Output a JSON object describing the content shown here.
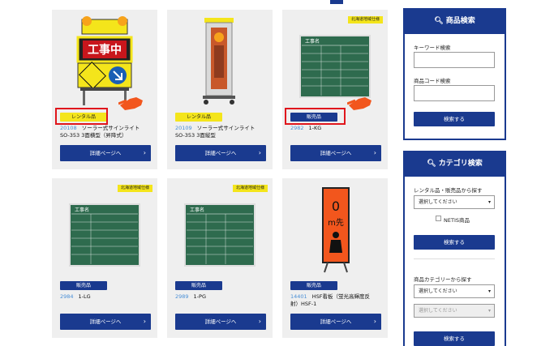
{
  "products": [
    {
      "badge": "レンタル品",
      "code": "20108",
      "name1": "ソーラー式サインライト",
      "name2": "SO-353 3面横型（昇降式）",
      "button": "詳細ページへ"
    },
    {
      "badge": "レンタル品",
      "code": "20109",
      "name1": "ソーラー式サインライト",
      "name2": "SO-353 3面縦型",
      "button": "詳細ページへ"
    },
    {
      "badge": "販売品",
      "code": "2982",
      "name1": "1-KG",
      "tag": "北海道地域仕様",
      "button": "詳細ページへ"
    },
    {
      "badge": "販売品",
      "code": "2984",
      "name1": "1-LG",
      "tag": "北海道地域仕様",
      "button": "詳細ページへ"
    },
    {
      "badge": "販売品",
      "code": "2989",
      "name1": "1-PG",
      "tag": "北海道地域仕様",
      "button": "詳細ページへ"
    },
    {
      "badge": "販売品",
      "code": "14401",
      "name1": "HSF看板（蛍光高輝度反",
      "name2": "射）HSF-1",
      "button": "詳細ページへ"
    }
  ],
  "sign_text": "工事中",
  "board": {
    "title": "工事名",
    "rows": [
      "工　　種",
      "施工場所",
      "位　　置",
      "設計寸法",
      "実測寸法",
      "立会者等名"
    ],
    "extra": "略　図"
  },
  "orange_sign": {
    "num": "0",
    "unit": "m先"
  },
  "sidebar": {
    "product_search": {
      "title": "商品検索",
      "keyword_label": "キーワード検索",
      "code_label": "商品コード検索",
      "button": "検索する"
    },
    "category_search": {
      "title": "カテゴリ検索",
      "rental_label": "レンタル品・販売品から探す",
      "select_placeholder": "選択してください",
      "netis_label": "NETIS商品",
      "button": "検索する",
      "category_label": "商品カテゴリーから探す",
      "select1": "選択してください",
      "select2": "選択してください",
      "button2": "検索する"
    }
  },
  "colors": {
    "navy": "#1a3a8f",
    "yellow": "#f4e51b",
    "red": "#e0161c",
    "link": "#4a8fd6",
    "board_green": "#2e6b4e",
    "sign_orange": "#f2561d"
  }
}
